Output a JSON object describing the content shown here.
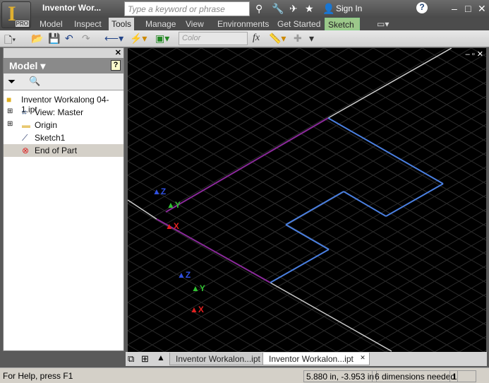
{
  "app": {
    "title": "Inventor Wor...",
    "badge": "PRO"
  },
  "search": {
    "placeholder": "Type a keyword or phrase"
  },
  "header": {
    "sign_in": "Sign In"
  },
  "ribbon_tabs": [
    {
      "label": "Model"
    },
    {
      "label": "Inspect"
    },
    {
      "label": "Tools",
      "active": true
    },
    {
      "label": "Manage"
    },
    {
      "label": "View"
    },
    {
      "label": "Environments"
    },
    {
      "label": "Get Started"
    },
    {
      "label": "Sketch"
    }
  ],
  "toolbar": {
    "color_placeholder": "Color",
    "fx": "fx"
  },
  "browser": {
    "title": "Model",
    "tree": [
      {
        "label": "Inventor Workalong 04-1.ipt",
        "icon": "part-icon"
      },
      {
        "label": "View: Master",
        "icon": "view-icon"
      },
      {
        "label": "Origin",
        "icon": "folder-icon"
      },
      {
        "label": "Sketch1",
        "icon": "sketch-icon"
      },
      {
        "label": "End of Part",
        "icon": "end-of-part-icon"
      }
    ]
  },
  "doc_tabs": [
    {
      "label": "Inventor Workalon...ipt"
    },
    {
      "label": "Inventor Workalon...ipt",
      "active": true
    }
  ],
  "status": {
    "help": "For Help, press F1",
    "coords": "5.880 in, -3.953 in",
    "dimensions": "6 dimensions needed",
    "count": "1"
  },
  "colors": {
    "sketch_line": "#4a7fe0",
    "projected_line": "#8a2a9a",
    "background": "#000000"
  }
}
